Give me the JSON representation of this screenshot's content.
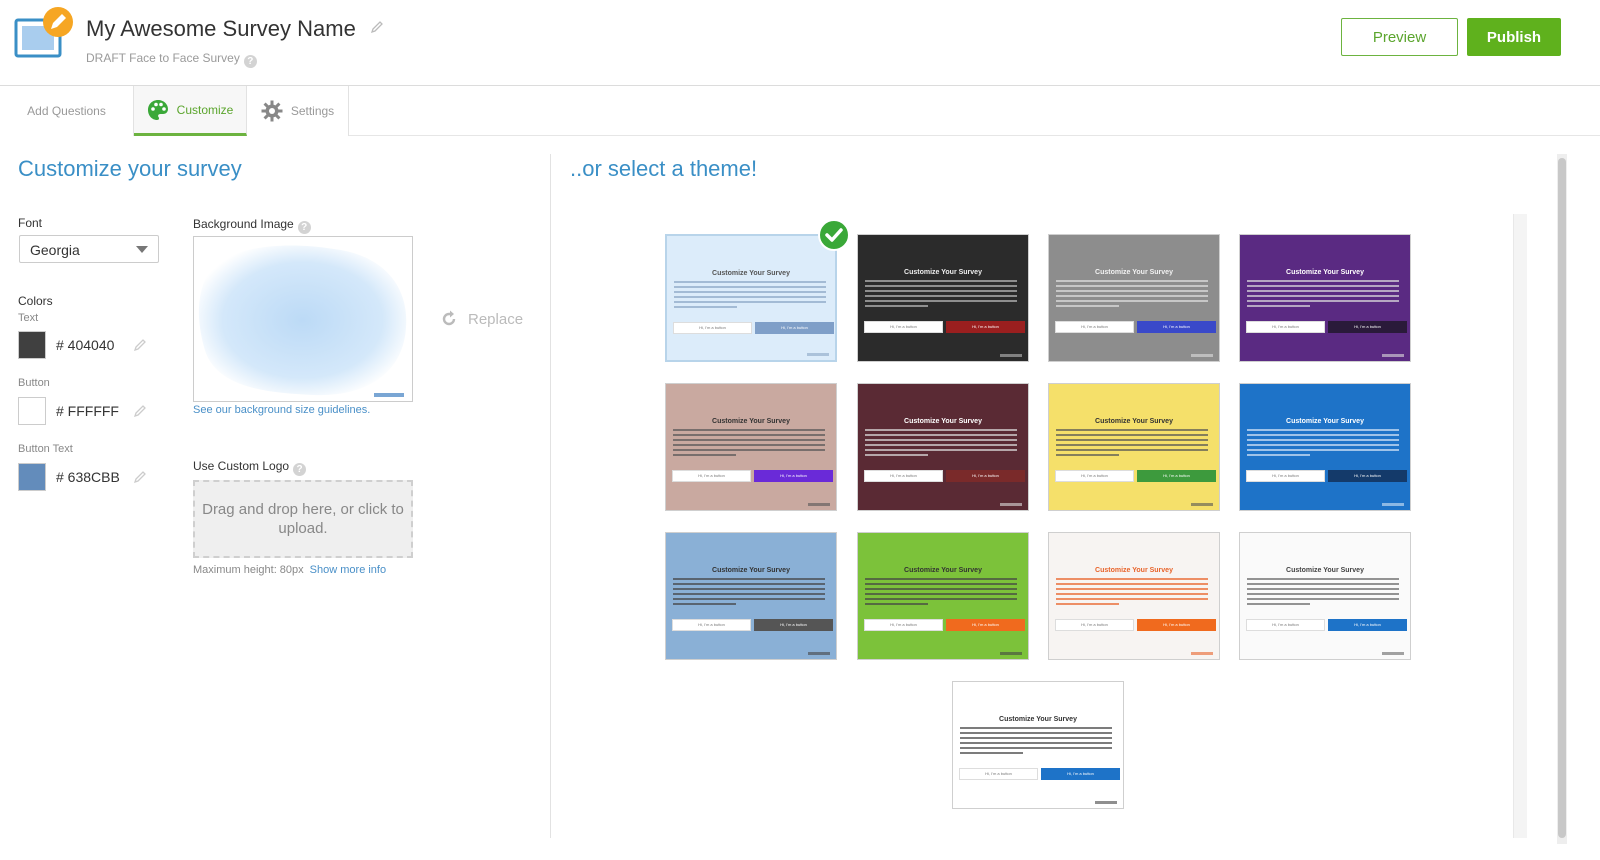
{
  "header": {
    "survey_title": "My Awesome Survey Name",
    "subtitle": "DRAFT Face to Face Survey",
    "help_mark": "?",
    "preview_label": "Preview",
    "publish_label": "Publish"
  },
  "tabs": [
    {
      "label": "Add Questions",
      "active": false
    },
    {
      "label": "Customize",
      "active": true
    },
    {
      "label": "Settings",
      "active": false
    }
  ],
  "left": {
    "title": "Customize your survey",
    "font_label": "Font",
    "font_value": "Georgia",
    "colors_label": "Colors",
    "colors": [
      {
        "label": "Text",
        "hex": "# 404040",
        "swatch": "#404040"
      },
      {
        "label": "Button",
        "hex": "# FFFFFF",
        "swatch": "#FFFFFF"
      },
      {
        "label": "Button Text",
        "hex": "# 638CBB",
        "swatch": "#638CBB"
      }
    ],
    "bg_label": "Background Image",
    "bg_link": "See our background size guidelines.",
    "replace_label": "Replace",
    "logo_label": "Use Custom Logo",
    "drop_text": "Drag and drop here, or click to upload.",
    "max_height": "Maximum height: 80px",
    "show_more": "Show more info"
  },
  "right": {
    "title": "..or select a theme!"
  },
  "themes": [
    {
      "name": "watercolor",
      "selected": true,
      "bg": "#dcecfa",
      "title": "Customize Your Survey",
      "title_color": "#555",
      "text_color": "#8aa6c4",
      "btn1": "Hi, I'm a button",
      "btn2": "Hi, I'm a button",
      "btn2_color": "#7f9fc8"
    },
    {
      "name": "dark",
      "selected": false,
      "bg": "#2b2b2b",
      "title": "Customize Your Survey",
      "title_color": "#eee",
      "text_color": "#bbb",
      "btn1": "Hi, I'm a button",
      "btn2": "Hi, I'm a button",
      "btn2_color": "#9a1f1f"
    },
    {
      "name": "gray",
      "selected": false,
      "bg": "#8d8d8d",
      "title": "Customize Your Survey",
      "title_color": "#f2f2f2",
      "text_color": "#e0e0e0",
      "btn1": "Hi, I'm a button",
      "btn2": "Hi, I'm a button",
      "btn2_color": "#3a49c9"
    },
    {
      "name": "purple",
      "selected": false,
      "bg": "#5a2a82",
      "title": "Customize Your Survey",
      "title_color": "#fff",
      "text_color": "#ddd",
      "btn1": "Hi, I'm a button",
      "btn2": "Hi, I'm a button",
      "btn2_color": "#2a1a3a"
    },
    {
      "name": "pastel-gradient",
      "selected": false,
      "bg": "#c9a9a0",
      "title": "Customize Your Survey",
      "title_color": "#333",
      "text_color": "#555",
      "btn1": "Hi, I'm a button",
      "btn2": "Hi, I'm a button",
      "btn2_color": "#6a2ad8"
    },
    {
      "name": "maroon",
      "selected": false,
      "bg": "#5a2a34",
      "title": "Customize Your Survey",
      "title_color": "#fff",
      "text_color": "#ddd",
      "btn1": "Hi, I'm a button",
      "btn2": "Hi, I'm a button",
      "btn2_color": "#7a2a2a"
    },
    {
      "name": "yellow",
      "selected": false,
      "bg": "#f5e06a",
      "title": "Customize Your Survey",
      "title_color": "#333",
      "text_color": "#555",
      "btn1": "Hi, I'm a button",
      "btn2": "Hi, I'm a button",
      "btn2_color": "#3d9a3d"
    },
    {
      "name": "blue",
      "selected": false,
      "bg": "#1e73c8",
      "title": "Customize Your Survey",
      "title_color": "#fff",
      "text_color": "#d6e6f6",
      "btn1": "Hi, I'm a button",
      "btn2": "Hi, I'm a button",
      "btn2_color": "#143a6a"
    },
    {
      "name": "blue-poly",
      "selected": false,
      "bg": "#8ab0d6",
      "title": "Customize Your Survey",
      "title_color": "#333",
      "text_color": "#444",
      "btn1": "Hi, I'm a button",
      "btn2": "Hi, I'm a button",
      "btn2_color": "#555"
    },
    {
      "name": "green",
      "selected": false,
      "bg": "#7cc23a",
      "title": "Customize Your Survey",
      "title_color": "#333",
      "text_color": "#444",
      "btn1": "Hi, I'm a button",
      "btn2": "Hi, I'm a button",
      "btn2_color": "#f06a1e"
    },
    {
      "name": "orange-pattern",
      "selected": false,
      "bg": "#f7f4f2",
      "title": "Customize Your Survey",
      "title_color": "#e8632a",
      "text_color": "#e8632a",
      "btn1": "Hi, I'm a button",
      "btn2": "Hi, I'm a button",
      "btn2_color": "#f06a1e"
    },
    {
      "name": "light-pattern",
      "selected": false,
      "bg": "#fafafa",
      "title": "Customize Your Survey",
      "title_color": "#444",
      "text_color": "#666",
      "btn1": "Hi, I'm a button",
      "btn2": "Hi, I'm a button",
      "btn2_color": "#1e73c8"
    },
    {
      "name": "plain-white",
      "selected": false,
      "bg": "#ffffff",
      "title": "Customize Your Survey",
      "title_color": "#333",
      "text_color": "#444",
      "btn1": "Hi, I'm a button",
      "btn2": "Hi, I'm a button",
      "btn2_color": "#1e73c8"
    }
  ]
}
